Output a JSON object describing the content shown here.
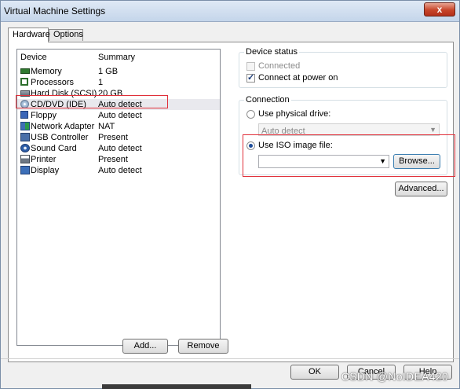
{
  "window": {
    "title": "Virtual Machine Settings",
    "close_glyph": "x"
  },
  "tabs": [
    {
      "label": "Hardware"
    },
    {
      "label": "Options"
    }
  ],
  "device_list": {
    "col_device": "Device",
    "col_summary": "Summary",
    "rows": [
      {
        "name": "Memory",
        "summary": "1 GB",
        "icon": "memory-icon"
      },
      {
        "name": "Processors",
        "summary": "1",
        "icon": "processor-icon"
      },
      {
        "name": "Hard Disk (SCSI)",
        "summary": "20 GB",
        "icon": "hard-disk-icon"
      },
      {
        "name": "CD/DVD (IDE)",
        "summary": "Auto detect",
        "icon": "cd-dvd-icon"
      },
      {
        "name": "Floppy",
        "summary": "Auto detect",
        "icon": "floppy-icon"
      },
      {
        "name": "Network Adapter",
        "summary": "NAT",
        "icon": "network-adapter-icon"
      },
      {
        "name": "USB Controller",
        "summary": "Present",
        "icon": "usb-icon"
      },
      {
        "name": "Sound Card",
        "summary": "Auto detect",
        "icon": "sound-card-icon"
      },
      {
        "name": "Printer",
        "summary": "Present",
        "icon": "printer-icon"
      },
      {
        "name": "Display",
        "summary": "Auto detect",
        "icon": "display-icon"
      }
    ],
    "add_label": "Add...",
    "remove_label": "Remove"
  },
  "device_status": {
    "title": "Device status",
    "connected_label": "Connected",
    "connected": false,
    "connect_power_label": "Connect at power on",
    "connect_power": true
  },
  "connection": {
    "title": "Connection",
    "physical_label": "Use physical drive:",
    "physical_value": "Auto detect",
    "iso_label": "Use ISO image file:",
    "iso_value": "",
    "browse_label": "Browse...",
    "advanced_label": "Advanced..."
  },
  "footer": {
    "ok_label": "OK",
    "cancel_label": "Cancel",
    "help_label": "Help"
  },
  "watermark": "CSDN @NoIDEA420",
  "colors": {
    "highlight_red": "#e0303a",
    "title_gradient_top": "#dfe9f5",
    "close_red": "#c7452a"
  }
}
